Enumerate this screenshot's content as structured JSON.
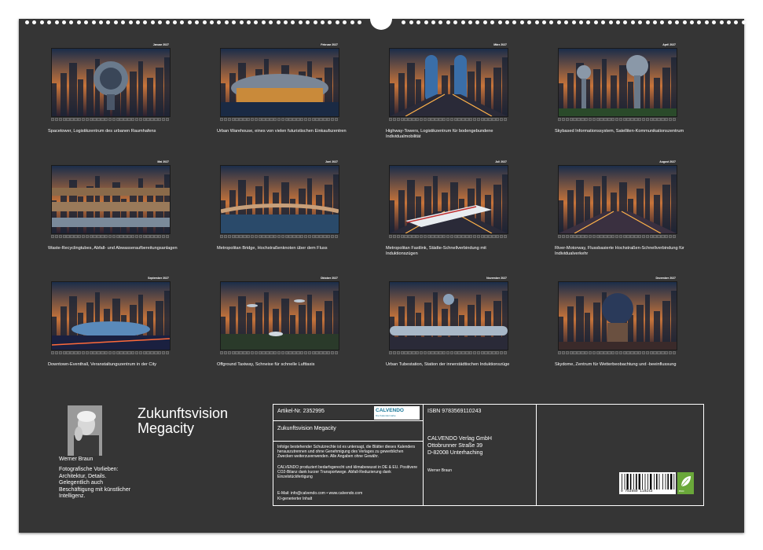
{
  "months": [
    {
      "month": "Januar 2027",
      "caption": "Spacetower, Logistikzentrum des urbanen Raumhafens",
      "scene": "tower"
    },
    {
      "month": "Februar 2027",
      "caption": "Urban Warehouse, eines von vielen futuristischen Einkaufszentren",
      "scene": "warehouse"
    },
    {
      "month": "März 2027",
      "caption": "Highway-Towers, Logistikzentrum für bodengebundene Individualmobilität",
      "scene": "highway"
    },
    {
      "month": "April 2027",
      "caption": "Skybased Informationssystem, Satelliten-Kommunikationszentrum",
      "scene": "spheres"
    },
    {
      "month": "Mai 2027",
      "caption": "Waste-Recyclingtubes, Abfall- und Abwasseraufbereitungsanlagen",
      "scene": "pipes"
    },
    {
      "month": "Juni 2027",
      "caption": "Metropolitan Bridge, Hochstraßenknoten über dem Fluss",
      "scene": "bridge"
    },
    {
      "month": "Juli 2027",
      "caption": "Metropolitan Fastlink, Städte-Schnellverbindung mit Induktionszügen",
      "scene": "train"
    },
    {
      "month": "August 2027",
      "caption": "River-Motorway, Flussbasierte Hochstraßen-Schnellverbindung für Individualverkehr",
      "scene": "river"
    },
    {
      "month": "September 2027",
      "caption": "Downtown-Eventhall, Veranstaltungszentrum in der City",
      "scene": "eventhall"
    },
    {
      "month": "Oktober 2027",
      "caption": "Offground Taxiway, Schneise für schnelle Lufttaxis",
      "scene": "taxiway"
    },
    {
      "month": "November 2027",
      "caption": "Urban Tubestation, Station der innerstädtischen Induktionszüge",
      "scene": "tube"
    },
    {
      "month": "Dezember 2027",
      "caption": "Skydome, Zentrum für Wetterbeobachtung und -beeinflussung",
      "scene": "dome"
    }
  ],
  "title": {
    "line1": "Zukunftsvision",
    "line2": "Megacity"
  },
  "author": {
    "name": "Werner Braun",
    "bio": "Fotografische Vorlieben: Architektur, Details. Gelegentlich auch Beschäftigung mit künstlicher Intelligenz."
  },
  "info": {
    "article": "Artikel-Nr. 2352995",
    "logo": "CALVENDO",
    "logo_sub": "Die Kalendermarke",
    "product_title": "Zukunftsvision Megacity",
    "legal1": "Infolge bestehender Schutzrechte ist es untersagt, die Blätter dieses Kalenders herauszutrennen und ohne Genehmigung des Verlages zu gewerblichen Zwecken weiterzuverwenden. Alle Angaben ohne Gewähr.",
    "legal2": "CALVENDO produziert bedarfsgerecht und klimabewusst in DE & EU. Positivere CO2-Bilanz dank kurzer Transportwege. Abfall-Reduzierung dank Einzelstückfertigung",
    "contact": "E-Mail: info@calvendo.com • www.calvendo.com",
    "ai": "KI-generierter Inhalt",
    "isbn": "ISBN 9783569110243",
    "publisher1": "CALVENDO Verlag GmbH",
    "publisher2": "Ottobrunner Straße 39",
    "publisher3": "D-82008 Unterhaching",
    "author_small": "Werner Braun",
    "barcode_num": "9 783569 110243",
    "eco_label": "eco"
  },
  "colors": {
    "page": "#353535",
    "text": "#ffffff",
    "eco": "#6aa83a",
    "brand": "#1a7a9a"
  }
}
